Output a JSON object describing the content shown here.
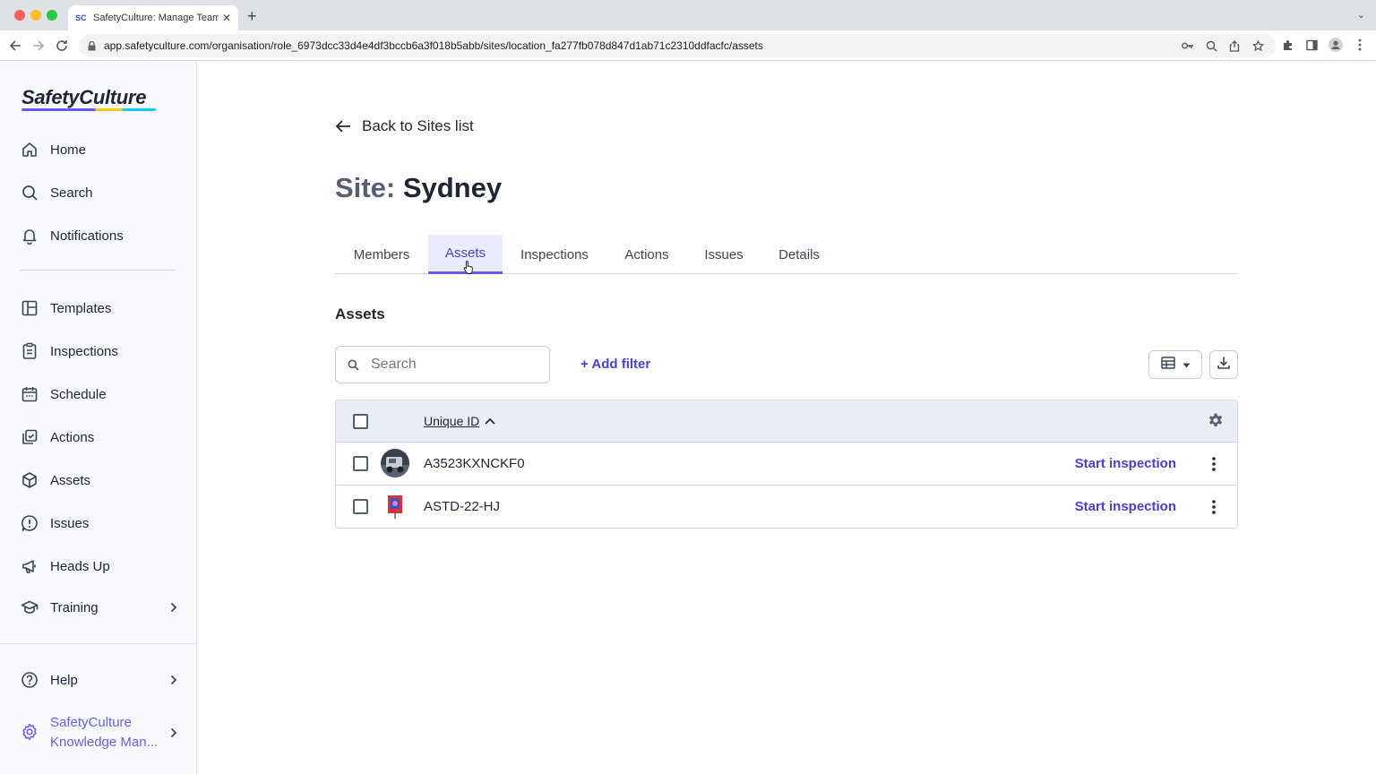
{
  "browser": {
    "tab_title": "SafetyCulture: Manage Teams",
    "tab_favicon": "SC",
    "url": "app.safetyculture.com/organisation/role_6973dcc33d4e4df3bccb6a3f018b5abb/sites/location_fa277fb078d847d1ab71c2310ddfacfc/assets"
  },
  "sidebar": {
    "logo": "SafetyCulture",
    "items": [
      {
        "label": "Home",
        "icon": "home-icon"
      },
      {
        "label": "Search",
        "icon": "search-icon"
      },
      {
        "label": "Notifications",
        "icon": "bell-icon"
      },
      {
        "label": "Templates",
        "icon": "templates-icon"
      },
      {
        "label": "Inspections",
        "icon": "clipboard-icon"
      },
      {
        "label": "Schedule",
        "icon": "calendar-icon"
      },
      {
        "label": "Actions",
        "icon": "actions-icon"
      },
      {
        "label": "Assets",
        "icon": "cube-icon"
      },
      {
        "label": "Issues",
        "icon": "issue-icon"
      },
      {
        "label": "Heads Up",
        "icon": "megaphone-icon"
      },
      {
        "label": "Training",
        "icon": "graduation-cap-icon"
      },
      {
        "label": "Help",
        "icon": "help-icon"
      }
    ],
    "org_line1": "SafetyCulture",
    "org_line2": "Knowledge Man..."
  },
  "main": {
    "back_label": "Back to Sites list",
    "title_prefix": "Site:",
    "title_name": "Sydney",
    "tabs": [
      {
        "label": "Members"
      },
      {
        "label": "Assets",
        "active": true
      },
      {
        "label": "Inspections"
      },
      {
        "label": "Actions"
      },
      {
        "label": "Issues"
      },
      {
        "label": "Details"
      }
    ],
    "section_title": "Assets",
    "search_placeholder": "Search",
    "add_filter": "+ Add filter",
    "table": {
      "column_header": "Unique ID",
      "sort": "ascending",
      "rows": [
        {
          "unique_id": "A3523KXNCKF0",
          "action": "Start inspection"
        },
        {
          "unique_id": "ASTD-22-HJ",
          "action": "Start inspection"
        }
      ]
    }
  },
  "colors": {
    "accent": "#675df4",
    "link": "#4740d4",
    "active_tab_bg": "#e9edff"
  }
}
